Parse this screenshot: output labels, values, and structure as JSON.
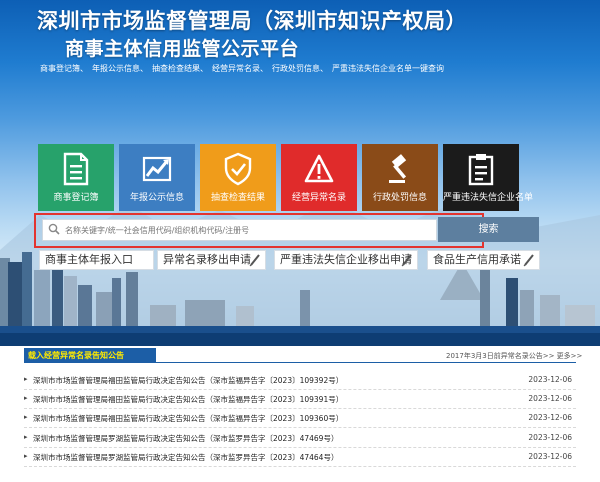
{
  "header": {
    "org_name": "深圳市市场监督管理局（深圳市知识产权局）",
    "platform_name": "商事主体信用监管公示平台",
    "nav_links": [
      "商事登记簿、",
      "年报公示信息、",
      "抽查检查结果、",
      "经营异常名录、",
      "行政处罚信息、",
      "严重违法失信企业名单一键查询"
    ]
  },
  "tiles": [
    {
      "label": "商事登记簿",
      "icon": "document-icon",
      "color": "#27a26b"
    },
    {
      "label": "年报公示信息",
      "icon": "chart-icon",
      "color": "#3d7ec2"
    },
    {
      "label": "抽查检查结果",
      "icon": "shield-check-icon",
      "color": "#f09c1a"
    },
    {
      "label": "经营异常名录",
      "icon": "warning-icon",
      "color": "#e02b2b"
    },
    {
      "label": "行政处罚信息",
      "icon": "gavel-icon",
      "color": "#8a4b18"
    },
    {
      "label": "严重违法失信企业名单",
      "icon": "clipboard-icon",
      "color": "#1b1b1b"
    }
  ],
  "search": {
    "placeholder": "名称关键字/统一社会信用代码/组织机构代码/注册号",
    "button_label": "搜索"
  },
  "quick_links": [
    "商事主体年报入口",
    "异常名录移出申请",
    "严重违法失信企业移出申请",
    "食品生产信用承诺"
  ],
  "notices": {
    "title": "载入经营异常名录告知公告",
    "more_link": "2017年3月3日前异常名录公告>> 更多>>",
    "items": [
      {
        "text": "深圳市市场监督管理局福田监管局行政决定告知公告（深市监福异告字〔2023〕109392号）",
        "date": "2023-12-06"
      },
      {
        "text": "深圳市市场监督管理局福田监管局行政决定告知公告（深市监福异告字〔2023〕109391号）",
        "date": "2023-12-06"
      },
      {
        "text": "深圳市市场监督管理局福田监管局行政决定告知公告（深市监福异告字〔2023〕109360号）",
        "date": "2023-12-06"
      },
      {
        "text": "深圳市市场监督管理局罗湖监管局行政决定告知公告（深市监罗异告字〔2023〕47469号）",
        "date": "2023-12-06"
      },
      {
        "text": "深圳市市场监督管理局罗湖监管局行政决定告知公告（深市监罗异告字〔2023〕47464号）",
        "date": "2023-12-06"
      }
    ]
  }
}
